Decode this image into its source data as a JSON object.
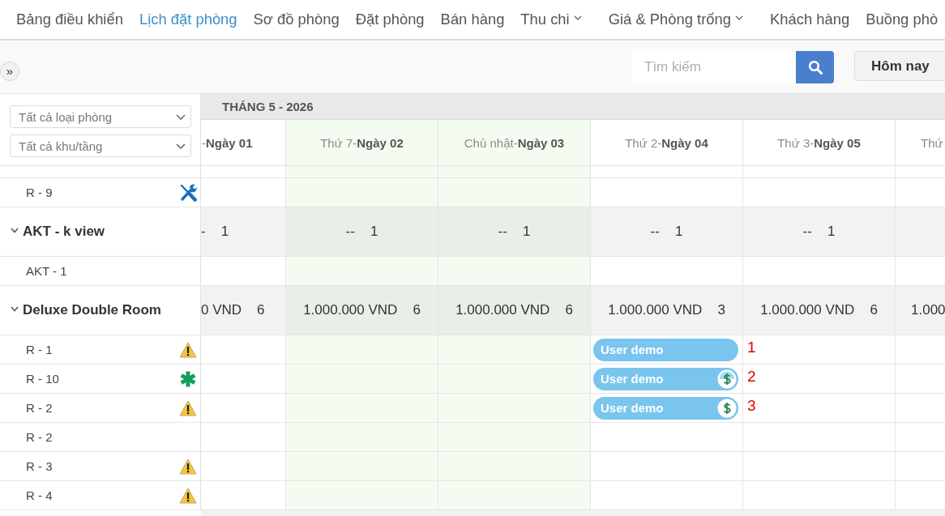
{
  "nav": {
    "tabs": [
      {
        "label": "Bảng điều khiển",
        "selected": false,
        "dropdown": false
      },
      {
        "label": "Lịch đặt phòng",
        "selected": true,
        "dropdown": false
      },
      {
        "label": "Sơ đồ phòng",
        "selected": false,
        "dropdown": false
      },
      {
        "label": "Đặt phòng",
        "selected": false,
        "dropdown": false
      },
      {
        "label": "Bán hàng",
        "selected": false,
        "dropdown": false
      },
      {
        "label": "Thu chi",
        "selected": false,
        "dropdown": true
      },
      {
        "label": "Giá & Phòng trống",
        "selected": false,
        "dropdown": true
      },
      {
        "label": "Khách hàng",
        "selected": false,
        "dropdown": false
      },
      {
        "label": "Buồng phò",
        "selected": false,
        "dropdown": false
      }
    ]
  },
  "toolbar": {
    "panel_toggle": "»",
    "search": {
      "placeholder": "Tìm kiếm"
    },
    "today_button": "Hôm nay"
  },
  "filters": [
    {
      "value": "Tất cả loại phòng"
    },
    {
      "value": "Tất cả khu/tầng"
    }
  ],
  "calendar": {
    "month": "THÁNG 5 - 2026",
    "columns": [
      {
        "label": "-**Ngày 01**",
        "color": "#ffffff"
      },
      {
        "label": "Thứ 7-**Ngày 02**",
        "color": "#f4fcf2"
      },
      {
        "label": "Chủ nhật-**Ngày 03**",
        "color": "#f4fcf2"
      },
      {
        "label": "Thứ 2-**Ngày 04**",
        "color": "#ffffff"
      },
      {
        "label": "Thứ 3-**Ngày 05**",
        "color": "#ffffff"
      },
      {
        "label": "Thứ",
        "color": "#ffffff"
      }
    ],
    "groups": [
      {
        "rooms": [
          {
            "name": "R - 9",
            "kind": "tools"
          }
        ]
      },
      {
        "name": "AKT - k view",
        "expanded": true,
        "summary": [
          {
            "price": "-",
            "count": "1"
          },
          {
            "price": "--",
            "count": "1"
          },
          {
            "price": "--",
            "count": "1"
          },
          {
            "price": "--",
            "count": "1"
          },
          {
            "price": "--",
            "count": "1"
          }
        ],
        "rooms": [
          {
            "name": "AKT - 1",
            "kind": "plain"
          }
        ]
      },
      {
        "name": "Deluxe Double Room",
        "expanded": true,
        "summary": [
          {
            "price": "0 VND",
            "count": "6"
          },
          {
            "price": "1.000.000 VND",
            "count": "6"
          },
          {
            "price": "1.000.000 VND",
            "count": "6"
          },
          {
            "price": "1.000.000 VND",
            "count": "3"
          },
          {
            "price": "1.000.000 VND",
            "count": "6"
          },
          {
            "price": "1.000"
          }
        ],
        "rooms": [
          {
            "name": "R - 1",
            "kind": "warning",
            "cells": [
              null,
              null,
              null,
              {
                "guest": "User demo",
                "kind": "unpaid",
                "annotation": "1"
              },
              null,
              null
            ]
          },
          {
            "name": "R - 10",
            "kind": "asterisk",
            "cells": [
              null,
              null,
              null,
              {
                "guest": "User demo",
                "kind": "partial",
                "annotation": "2"
              },
              null,
              null
            ]
          },
          {
            "name": "R - 2",
            "kind": "warning",
            "cells": [
              null,
              null,
              null,
              {
                "guest": "User demo",
                "kind": "paid",
                "annotation": "3"
              },
              null,
              null
            ]
          },
          {
            "name": "R - 2",
            "kind": "plain"
          },
          {
            "name": "R - 3",
            "kind": "warning"
          },
          {
            "name": "R - 4",
            "kind": "warning"
          }
        ]
      }
    ]
  }
}
